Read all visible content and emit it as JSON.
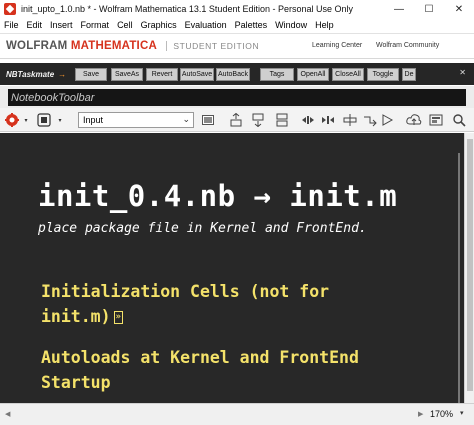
{
  "window": {
    "title": "init_upto_1.0.nb * - Wolfram Mathematica 13.1 Student Edition - Personal Use Only",
    "minimize_label": "—",
    "maximize_label": "☐",
    "close_label": "✕"
  },
  "menu": [
    "File",
    "Edit",
    "Insert",
    "Format",
    "Cell",
    "Graphics",
    "Evaluation",
    "Palettes",
    "Window",
    "Help"
  ],
  "brand": {
    "wolfram": "WOLFRAM",
    "mathematica": "MATHEMATICA",
    "edition": "STUDENT EDITION",
    "learning_center": "Learning Center",
    "wolfram_community": "Wolfram Community"
  },
  "taskmate": {
    "label": "NBTaskmate",
    "arrow": "→",
    "buttons": [
      "Save",
      "SaveAs",
      "Revert",
      "AutoSave",
      "AutoBack",
      "Tags",
      "OpenAll",
      "CloseAll",
      "Toggle",
      "De"
    ],
    "close": "✕"
  },
  "notebook_toolbar": {
    "label": "NotebookToolbar"
  },
  "toolbar": {
    "style_value": "Input",
    "icons": [
      "gear-icon",
      "stop-icon",
      "cell-style-dropdown-icon",
      "cell-frame-icon",
      "insert-above-icon",
      "insert-below-icon",
      "open-group-icon",
      "close-group-icon",
      "assign-icon",
      "chain-icon",
      "evaluate-icon",
      "cloud-publish-icon",
      "image-icon",
      "search-icon"
    ]
  },
  "notebook": {
    "title": "init_0.4.nb → init.m",
    "subtitle": "place package file in Kernel and FrontEnd.",
    "section1_line1": "Initialization Cells (not for",
    "section1_line2": "init.m)",
    "section1_group": "»",
    "section2_line1": "Autoloads at Kernel and FrontEnd",
    "section2_line2": "Startup"
  },
  "status": {
    "zoom": "170%"
  },
  "colors": {
    "notebook_bg": "#282828",
    "section_text": "#f4e26a",
    "brand_red": "#d6321d",
    "taskmate_bg": "#262626"
  }
}
